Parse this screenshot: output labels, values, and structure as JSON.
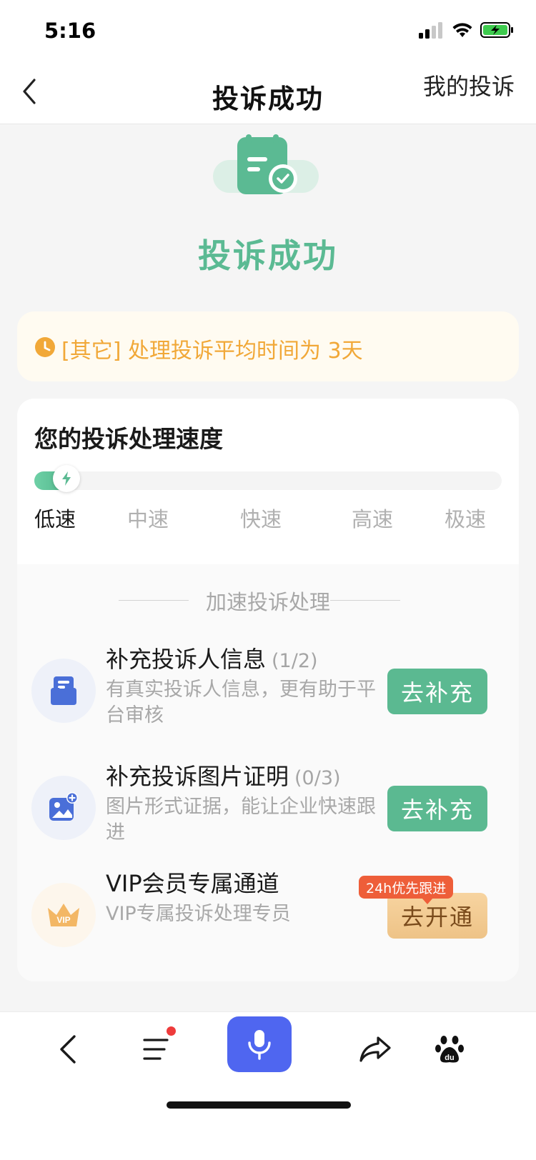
{
  "status_bar": {
    "time": "5:16"
  },
  "nav": {
    "title": "投诉成功",
    "right_link": "我的投诉"
  },
  "hero": {
    "title": "投诉成功"
  },
  "notice": {
    "text": "[其它] 处理投诉平均时间为 3天"
  },
  "speed": {
    "title": "您的投诉处理速度",
    "progress_fraction": 0.08,
    "labels": [
      "低速",
      "中速",
      "快速",
      "高速",
      "极速"
    ],
    "active_index": 0
  },
  "accelerate": {
    "title": "加速投诉处理",
    "tasks": [
      {
        "title": "补充投诉人信息",
        "count": "(1/2)",
        "desc": "有真实投诉人信息，更有助于平台审核",
        "button": "去补充"
      },
      {
        "title": "补充投诉图片证明",
        "count": "(0/3)",
        "desc": "图片形式证据，能让企业快速跟进",
        "button": "去补充"
      },
      {
        "title": "VIP会员专属通道",
        "count": "",
        "desc": "VIP专属投诉处理专员",
        "button": "去开通",
        "badge": "24h优先跟进",
        "icon_text": "VIP"
      }
    ]
  },
  "toolbar": {
    "items": [
      "back-icon",
      "menu-icon",
      "mic-icon",
      "share-icon",
      "baidu-paw-icon"
    ]
  },
  "colors": {
    "accent_green": "#5bba93",
    "notice_orange": "#f1a838",
    "mic_blue": "#4f66f0",
    "badge_red": "#ee5e39"
  }
}
